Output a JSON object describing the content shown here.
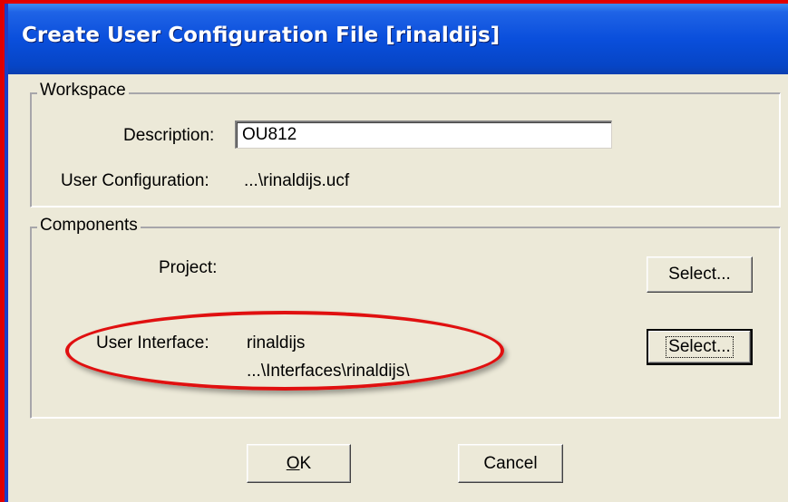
{
  "window": {
    "title": "Create User Configuration File [rinaldijs]"
  },
  "workspace": {
    "group_label": "Workspace",
    "description_label": "Description:",
    "description_value": "OU812",
    "user_config_label": "User Configuration:",
    "user_config_value": "...\\rinaldijs.ucf"
  },
  "components": {
    "group_label": "Components",
    "project_label": "Project:",
    "project_select_label": "Select...",
    "user_interface_label": "User Interface:",
    "user_interface_name": "rinaldijs",
    "user_interface_path": "...\\Interfaces\\rinaldijs\\",
    "user_interface_select_label": "Select..."
  },
  "buttons": {
    "ok_label": "OK",
    "ok_mnemonic": "O",
    "ok_rest": "K",
    "cancel_label": "Cancel"
  },
  "colors": {
    "titlebar": "#0a4fdc",
    "dialog_bg": "#ece9d8",
    "annotation": "#e01010"
  }
}
